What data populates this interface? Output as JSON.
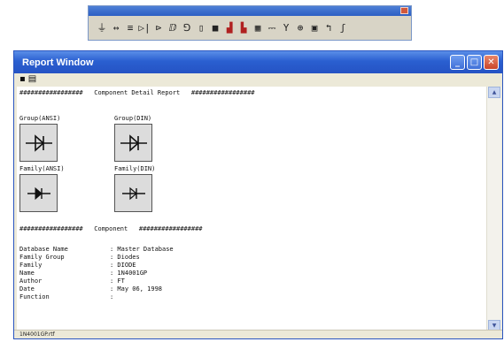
{
  "toolbar": {
    "buttons": [
      {
        "name": "ground-icon",
        "glyph": "⏚"
      },
      {
        "name": "source-icon",
        "glyph": "↔"
      },
      {
        "name": "basic-icon",
        "glyph": "≡"
      },
      {
        "name": "diode-icon",
        "glyph": "▷|"
      },
      {
        "name": "transistor-icon",
        "glyph": "⊳"
      },
      {
        "name": "analog-icon",
        "glyph": "ⅅ"
      },
      {
        "name": "ttl-icon",
        "glyph": "⅁"
      },
      {
        "name": "cmos-icon",
        "glyph": "▯"
      },
      {
        "name": "misc-digital-icon",
        "glyph": "■"
      },
      {
        "name": "mixed-icon",
        "glyph": "▟"
      },
      {
        "name": "indicator-icon",
        "glyph": "▙"
      },
      {
        "name": "power-icon",
        "glyph": "▦"
      },
      {
        "name": "misc-icon",
        "glyph": "⎓"
      },
      {
        "name": "rf-icon",
        "glyph": "Y"
      },
      {
        "name": "electromech-icon",
        "glyph": "⊕"
      },
      {
        "name": "place-hierarchical-icon",
        "glyph": "▣"
      },
      {
        "name": "bus-icon",
        "glyph": "↰"
      },
      {
        "name": "wire-icon",
        "glyph": "ʃ"
      }
    ]
  },
  "window": {
    "title": "Report Window",
    "tools": [
      {
        "name": "save-icon",
        "glyph": "▪"
      },
      {
        "name": "print-icon",
        "glyph": "▤"
      }
    ]
  },
  "report": {
    "header_line": "#################   Component Detail Report   #################",
    "group_ansi_label": "Group(ANSI)",
    "group_din_label": "Group(DIN)",
    "family_ansi_label": "Family(ANSI)",
    "family_din_label": "Family(DIN)",
    "component_line": "#################   Component   #################",
    "fields": [
      {
        "key": "Database Name",
        "value": ": Master Database"
      },
      {
        "key": "Family Group",
        "value": ": Diodes"
      },
      {
        "key": "Family",
        "value": ": DIODE"
      },
      {
        "key": "Name",
        "value": ": 1N4001GP"
      },
      {
        "key": "Author",
        "value": ": FT"
      },
      {
        "key": "Date",
        "value": ": May 06, 1998"
      },
      {
        "key": "Function",
        "value": ":"
      }
    ]
  },
  "status": {
    "text": "1N4001GP.rtf"
  },
  "colors": {
    "title_bar": "#2a5fd0",
    "window_face": "#ece9d8",
    "symbol_bg": "#dcdcdc"
  }
}
